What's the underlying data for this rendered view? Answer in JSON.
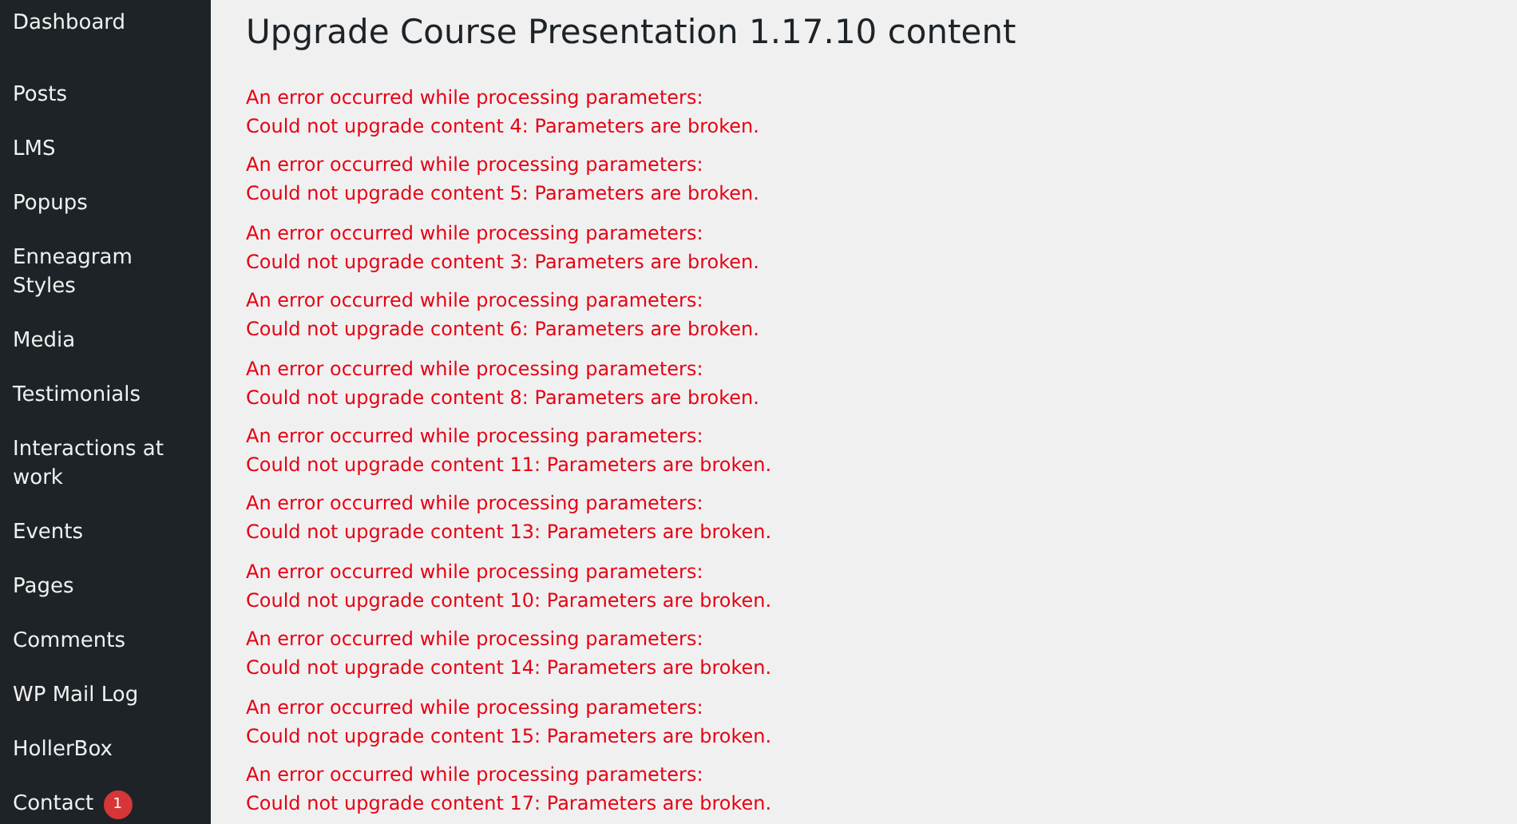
{
  "sidebar": {
    "items": [
      {
        "label": "Dashboard"
      },
      {
        "label": "Posts"
      },
      {
        "label": "LMS"
      },
      {
        "label": "Popups"
      },
      {
        "label": "Enneagram Styles"
      },
      {
        "label": "Media"
      },
      {
        "label": "Testimonials"
      },
      {
        "label": "Interactions at work"
      },
      {
        "label": "Events"
      },
      {
        "label": "Pages"
      },
      {
        "label": "Comments"
      },
      {
        "label": "WP Mail Log"
      },
      {
        "label": "HollerBox"
      },
      {
        "label": "Contact",
        "badge": "1"
      }
    ]
  },
  "page_title": "Upgrade Course Presentation 1.17.10 content",
  "errors": [
    {
      "heading": "An error occurred while processing parameters:",
      "detail": "Could not upgrade content 4: Parameters are broken."
    },
    {
      "heading": "An error occurred while processing parameters:",
      "detail": "Could not upgrade content 5: Parameters are broken."
    },
    {
      "heading": "An error occurred while processing parameters:",
      "detail": "Could not upgrade content 3: Parameters are broken."
    },
    {
      "heading": "An error occurred while processing parameters:",
      "detail": "Could not upgrade content 6: Parameters are broken."
    },
    {
      "heading": "An error occurred while processing parameters:",
      "detail": "Could not upgrade content 8: Parameters are broken."
    },
    {
      "heading": "An error occurred while processing parameters:",
      "detail": "Could not upgrade content 11: Parameters are broken."
    },
    {
      "heading": "An error occurred while processing parameters:",
      "detail": "Could not upgrade content 13: Parameters are broken."
    },
    {
      "heading": "An error occurred while processing parameters:",
      "detail": "Could not upgrade content 10: Parameters are broken."
    },
    {
      "heading": "An error occurred while processing parameters:",
      "detail": "Could not upgrade content 14: Parameters are broken."
    },
    {
      "heading": "An error occurred while processing parameters:",
      "detail": "Could not upgrade content 15: Parameters are broken."
    },
    {
      "heading": "An error occurred while processing parameters:",
      "detail": "Could not upgrade content 17: Parameters are broken."
    }
  ]
}
